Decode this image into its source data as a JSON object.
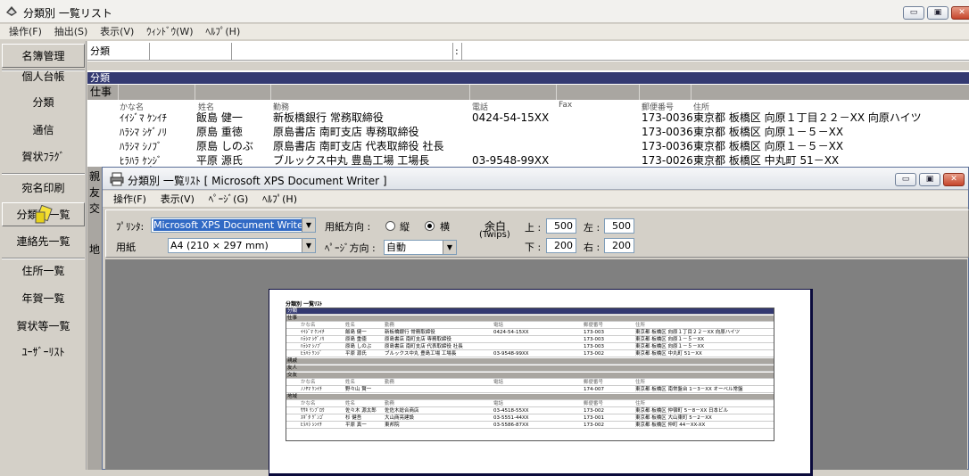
{
  "app": {
    "title": "分類別 一覧リスト",
    "menu": [
      "操作(F)",
      "抽出(S)",
      "表示(V)",
      "ｳｨﾝﾄﾞｳ(W)",
      "ﾍﾙﾌﾟ(H)"
    ],
    "window_buttons": {
      "minimize": "▭",
      "restore": "▣",
      "close": "✕"
    }
  },
  "sidebar": {
    "items": [
      "名簿管理",
      "個人台帳",
      "分類",
      "通信",
      "賀状ﾌﾗｸﾞ",
      "宛名印刷",
      "分類別一覧",
      "連絡先一覧",
      "住所一覧",
      "年賀一覧",
      "賀状等一覧",
      "ﾕｰｻﾞｰﾘｽﾄ"
    ]
  },
  "filter": {
    "label": "分類",
    "separator": ":"
  },
  "list": {
    "section_title": "分類",
    "category": "仕事",
    "columns": [
      "かな名",
      "姓名",
      "勤務",
      "電話",
      "Fax",
      "郵便番号",
      "住所"
    ],
    "rows": [
      [
        "ｲｲｼﾞﾏ ｹﾝｲﾁ",
        "飯島 健一",
        "新板橋銀行 常務取締役",
        "0424-54-15XX",
        "",
        "173-0036",
        "東京都 板橋区 向原１丁目２２－XX 向原ハイツ"
      ],
      [
        "ﾊﾗｼﾏ ｼｹﾞﾉﾘ",
        "原島 重徳",
        "原島書店 南町支店 専務取締役",
        "",
        "",
        "173-0036",
        "東京都 板橋区 向原１－５－XX"
      ],
      [
        "ﾊﾗｼﾏ ｼﾉﾌﾞ",
        "原島 しのぶ",
        "原島書店 南町支店 代表取締役 社長",
        "",
        "",
        "173-0036",
        "東京都 板橋区 向原１－５－XX"
      ],
      [
        "ﾋﾗﾊﾗ ｹﾝｼﾞ",
        "平原 源氏",
        "ブルックス中丸 豊島工場 工場長",
        "03-9548-99XX",
        "",
        "173-0026",
        "東京都 板橋区 中丸町 51－XX"
      ]
    ],
    "left_categories": [
      "親",
      "友",
      "交",
      "地"
    ]
  },
  "print_dialog": {
    "title": "分類別 一覧ﾘｽﾄ [ Microsoft XPS Document Writer ]",
    "menu": [
      "操作(F)",
      "表示(V)",
      "ﾍﾟｰｼﾞ(G)",
      "ﾍﾙﾌﾟ(H)"
    ],
    "printer_label": "ﾌﾟﾘﾝﾀ:",
    "printer_value": "Microsoft XPS Document Writer",
    "paper_label": "用紙",
    "paper_value": "A4 (210 × 297 mm)",
    "orientation_label": "用紙方向 :",
    "orientation_portrait": "縦",
    "orientation_landscape": "横",
    "orientation_selected": "横",
    "page_dir_label": "ﾍﾟｰｼﾞ方向 :",
    "page_dir_value": "自動",
    "margin_label": "余白",
    "margin_unit": "(Twips)",
    "margin_top_label": "上 :",
    "margin_top": "500",
    "margin_left_label": "左 :",
    "margin_left": "500",
    "margin_bottom_label": "下 :",
    "margin_bottom": "200",
    "margin_right_label": "右 :",
    "margin_right": "200"
  },
  "preview": {
    "title": "分類別 一覧ﾘｽﾄ",
    "section": "分類",
    "groups": [
      {
        "name": "仕事",
        "rows": [
          [
            "ｲｲｼﾞﾏ ｹﾝｲﾁ",
            "飯島 健一",
            "新板橋銀行 常務取締役",
            "0424-54-15XX",
            "173-003",
            "東京都 板橋区 向原１丁目２２－XX 向原ハイツ"
          ],
          [
            "ﾊﾗｼﾏ ｼｹﾞﾉﾘ",
            "原島 重徳",
            "原島書店 南町支店 専務取締役",
            "",
            "173-003",
            "東京都 板橋区 向原１－５－XX"
          ],
          [
            "ﾊﾗｼﾏ ｼﾉﾌﾞ",
            "原島 しのぶ",
            "原島書店 南町支店 代表取締役 社長",
            "",
            "173-003",
            "東京都 板橋区 向原１－５－XX"
          ],
          [
            "ﾋﾗﾊﾗ ｹﾝｼﾞ",
            "平原 源氏",
            "ブルックス中丸 豊島工場 工場長",
            "03-9548-99XX",
            "173-002",
            "東京都 板橋区 中丸町 51－XX"
          ]
        ]
      },
      {
        "name": "親戚",
        "rows": []
      },
      {
        "name": "友人",
        "rows": []
      },
      {
        "name": "交友",
        "rows": [
          [
            "ﾉﾉﾔﾏ ｹﾝｲﾁ",
            "野々山 賢一",
            "",
            "",
            "174-007",
            "東京都 板橋区 南常盤台 1－3－XX オーベル常盤"
          ]
        ]
      },
      {
        "name": "地域",
        "rows": [
          [
            "ｻｻｷ ｹﾝﾌﾞﾛｳ",
            "佐々木 源太郎",
            "佐佐木総合商店",
            "03-4518-55XX",
            "173-002",
            "東京都 板橋区 仲宿町 5－8－XX 日本ビル"
          ],
          [
            "ｽｷﾞﾀ ｹﾞﾝｺﾞ",
            "杉 健吾",
            "大山商亮建設",
            "03-5551-44XX",
            "173-001",
            "東京都 板橋区 大山東町 5－2－XX"
          ],
          [
            "ﾋﾗﾊﾗ ｼﾝｲﾁ",
            "平原 真一",
            "東邦院",
            "03-5586-87XX",
            "173-002",
            "東京都 板橋区 仲町 44－XX-XX"
          ]
        ]
      }
    ]
  }
}
